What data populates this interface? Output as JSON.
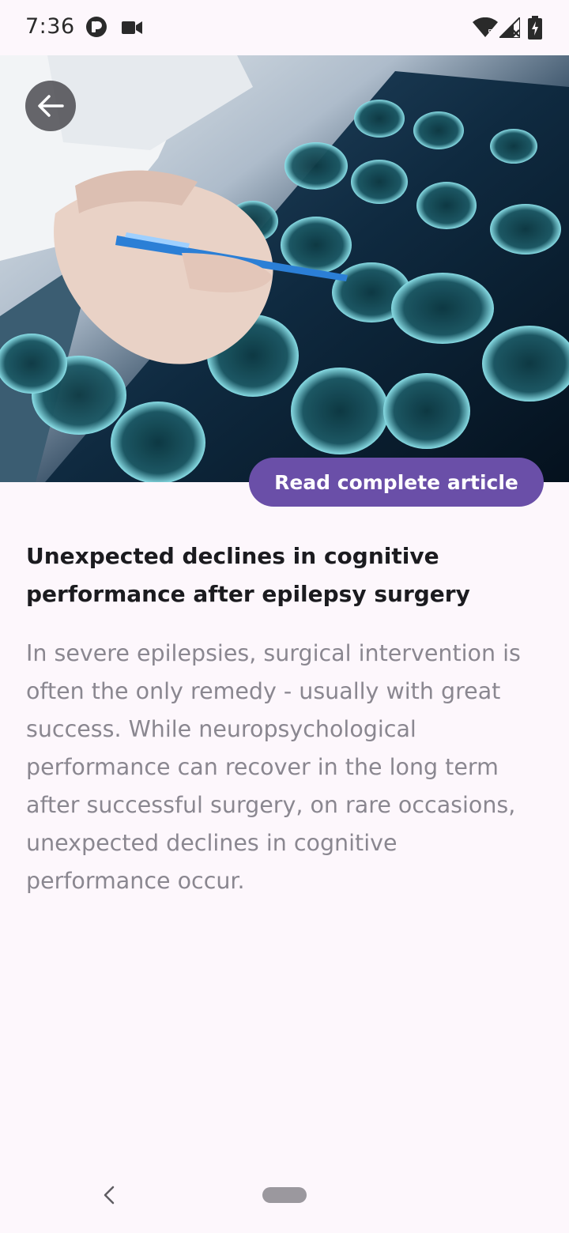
{
  "status_bar": {
    "time": "7:36",
    "left_icons": [
      "app-notification-icon",
      "video-camera-icon"
    ],
    "right_icons": [
      "wifi-icon",
      "signal-icon",
      "battery-charging-icon"
    ]
  },
  "hero": {
    "image": "brain-ct-scan-photo",
    "back_icon": "arrow-left-icon"
  },
  "article": {
    "read_button_label": "Read complete article",
    "title": "Unexpected declines in cognitive performance after epilepsy surgery",
    "body": "In severe epilepsies, surgical intervention is often the only remedy - usually with great success. While neuropsychological performance can recover in the long term after successful surgery, on rare occasions, unexpected declines in cognitive performance occur."
  },
  "nav_bar": {
    "back_icon": "chevron-left-icon",
    "home_icon": "home-pill-icon"
  },
  "colors": {
    "background": "#fdf7fc",
    "accent": "#6a4fa8",
    "title_text": "#1b1b1f",
    "body_text": "#8a8790"
  }
}
